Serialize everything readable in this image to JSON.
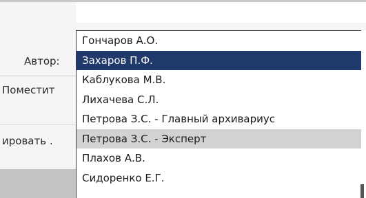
{
  "form": {
    "author_label": "Автор:",
    "place_label": "Поместит",
    "edit_label": "ировать ."
  },
  "author_dropdown": {
    "options": [
      "Гончаров А.О.",
      "Захаров П.Ф.",
      "Каблукова М.В.",
      "Лихачева С.Л.",
      "Петрова З.С. - Главный архивариус",
      "Петрова З.С. - Эксперт",
      "Плахов А.В.",
      "Сидоренко Е.Г."
    ],
    "selected_option": "Захаров П.Ф.",
    "hovered_option": "Петрова З.С. - Эксперт"
  },
  "colors": {
    "selected_bg": "#1f3a6a",
    "hover_bg": "#d2d2d2"
  }
}
